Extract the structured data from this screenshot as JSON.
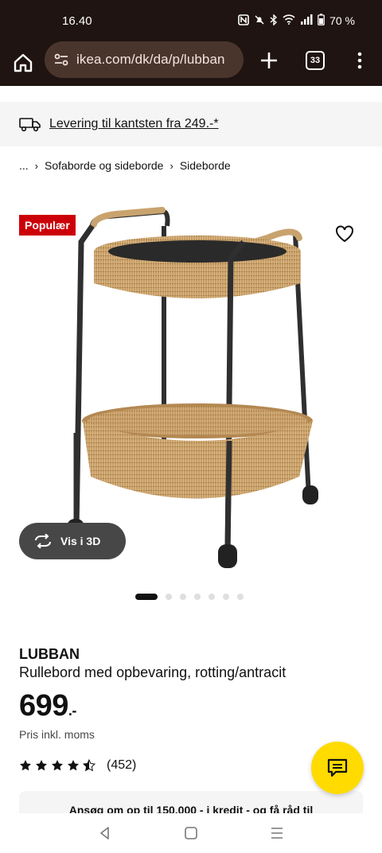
{
  "status": {
    "time": "16.40",
    "battery": "70 %",
    "icons": [
      "nfc-icon",
      "mute-icon",
      "bluetooth-icon",
      "wifi-icon",
      "signal-icon",
      "battery-icon"
    ]
  },
  "browser": {
    "url": "ikea.com/dk/da/p/lubban",
    "tab_count": "33"
  },
  "delivery": {
    "text": "Levering til kantsten fra 249.-*"
  },
  "breadcrumb": {
    "items": [
      "...",
      "Sofaborde og sideborde",
      "Sideborde"
    ]
  },
  "product": {
    "badge": "Populær",
    "view3d_label": "Vis i 3D",
    "brand": "LUBBAN",
    "description": "Rullebord med opbevaring, rotting/antracit",
    "price": "699",
    "price_suffix": ".-",
    "price_note": "Pris inkl. moms",
    "rating": 4.5,
    "review_count": "(452)",
    "carousel_total": 7,
    "carousel_active": 1
  },
  "credit_banner": {
    "text": "Ansøg om op til 150.000 - i kredit - og få råd til"
  },
  "colors": {
    "browser_bg": "#1f1411",
    "url_pill": "#4a352d",
    "badge_red": "#cc0008",
    "chat_yellow": "#ffdb00"
  }
}
